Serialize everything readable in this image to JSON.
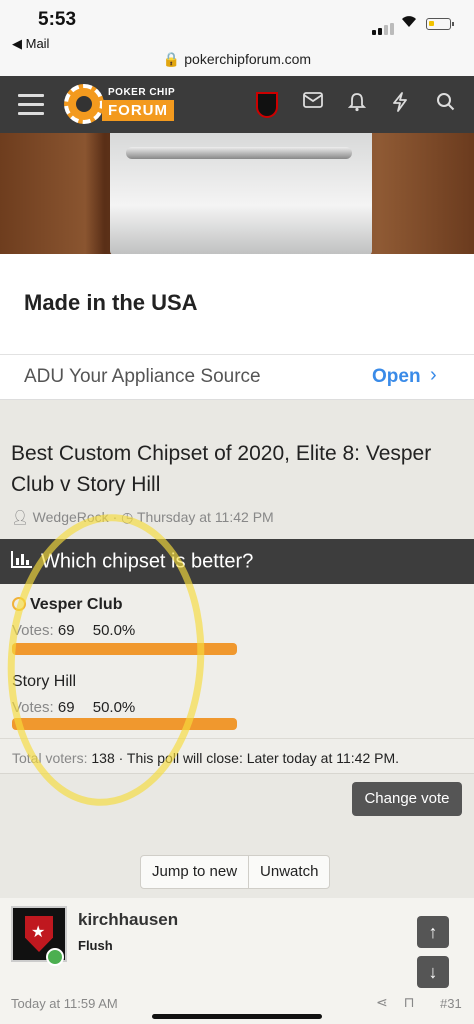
{
  "status_bar": {
    "time": "5:53",
    "back_app": "◀ Mail",
    "url": "pokerchipforum.com"
  },
  "nav": {
    "logo_top": "POKER CHIP",
    "logo_bottom": "FORUM"
  },
  "ad": {
    "headline": "Made in the USA",
    "source": "ADU Your Appliance Source",
    "cta": "Open"
  },
  "thread": {
    "title": "Best Custom Chipset of 2020, Elite 8: Vesper Club v Story Hill",
    "author": "WedgeRock",
    "date": "Thursday at 11:42 PM"
  },
  "poll": {
    "question": "Which chipset is better?",
    "votes_label": "Votes:",
    "options": [
      {
        "name": "Vesper Club",
        "votes": "69",
        "percent": "50.0%",
        "share": 0.5,
        "voted": true
      },
      {
        "name": "Story Hill",
        "votes": "69",
        "percent": "50.0%",
        "share": 0.5,
        "voted": false
      }
    ],
    "total_label": "Total voters:",
    "total": "138",
    "close_text": "· This poll will close: Later today at 11:42 PM.",
    "change_vote": "Change vote"
  },
  "actions": {
    "jump": "Jump to new",
    "unwatch": "Unwatch"
  },
  "post": {
    "username": "kirchhausen",
    "user_title": "Flush",
    "date": "Today at 11:59 AM",
    "number": "#31"
  },
  "annotation_color": "#f6dc3c"
}
